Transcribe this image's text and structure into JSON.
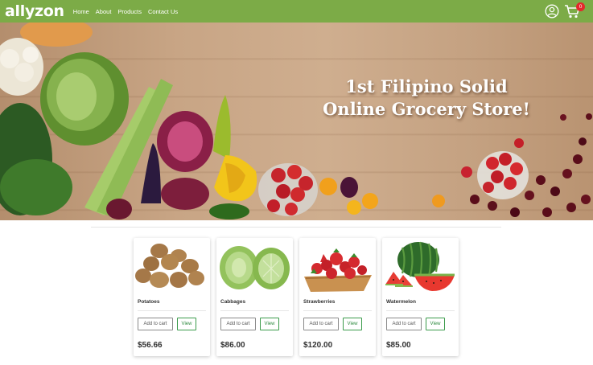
{
  "brand": {
    "logo": "allyzon"
  },
  "nav": {
    "items": [
      "Home",
      "About",
      "Products",
      "Contact Us"
    ]
  },
  "cart": {
    "count": "0"
  },
  "hero": {
    "line1": "1st Filipino Solid",
    "line2": "Online Grocery Store!"
  },
  "products": [
    {
      "name": "Potatoes",
      "price": "$56.66",
      "add_label": "Add to cart",
      "view_label": "View"
    },
    {
      "name": "Cabbages",
      "price": "$86.00",
      "add_label": "Add to cart",
      "view_label": "View"
    },
    {
      "name": "Strawberries",
      "price": "$120.00",
      "add_label": "Add to cart",
      "view_label": "View"
    },
    {
      "name": "Watermelon",
      "price": "$85.00",
      "add_label": "Add to cart",
      "view_label": "View"
    }
  ],
  "colors": {
    "brand": "#7cab47",
    "badge": "#e4282c",
    "view_border": "#3b9b4b"
  },
  "icons": {
    "user": "user-circle-icon",
    "cart": "shopping-cart-icon"
  }
}
